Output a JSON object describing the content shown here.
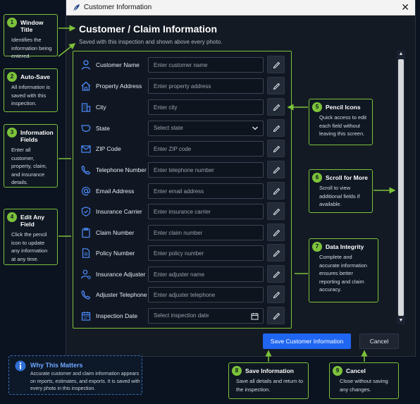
{
  "window": {
    "title": "Customer Information",
    "close": "✕"
  },
  "header": {
    "title": "Customer / Claim Information",
    "subtitle": "Saved with this inspection and shown above every photo."
  },
  "fields": [
    {
      "label": "Customer Name",
      "placeholder": "Enter customer name",
      "icon": "person-icon"
    },
    {
      "label": "Property Address",
      "placeholder": "Enter property address",
      "icon": "home-icon"
    },
    {
      "label": "City",
      "placeholder": "Enter city",
      "icon": "building-icon"
    },
    {
      "label": "State",
      "placeholder": "Select state",
      "icon": "map-icon",
      "type": "select"
    },
    {
      "label": "ZIP Code",
      "placeholder": "Enter ZIP code",
      "icon": "envelope-icon"
    },
    {
      "label": "Telephone Number",
      "placeholder": "Enter telephone number",
      "icon": "phone-icon"
    },
    {
      "label": "Email Address",
      "placeholder": "Enter email address",
      "icon": "at-sign-icon"
    },
    {
      "label": "Insurance Carrier",
      "placeholder": "Enter insurance carrier",
      "icon": "shield-icon"
    },
    {
      "label": "Claim Number",
      "placeholder": "Enter claim number",
      "icon": "clipboard-icon"
    },
    {
      "label": "Policy Number",
      "placeholder": "Enter policy number",
      "icon": "document-icon"
    },
    {
      "label": "Insurance Adjuster",
      "placeholder": "Enter adjuster name",
      "icon": "user-gear-icon"
    },
    {
      "label": "Adjuster Telephone",
      "placeholder": "Enter adjuster telephone",
      "icon": "phone-icon"
    },
    {
      "label": "Inspection Date",
      "placeholder": "Select inspection date",
      "icon": "calendar-icon",
      "type": "date"
    }
  ],
  "buttons": {
    "save": "Save Customer Information",
    "cancel": "Cancel"
  },
  "callouts": {
    "c1": {
      "num": "1",
      "title": "Window Title",
      "body": "Identifies the information being entered."
    },
    "c2": {
      "num": "2",
      "title": "Auto-Save",
      "body": "All information is saved with this inspection."
    },
    "c3": {
      "num": "3",
      "title": "Information Fields",
      "body": "Enter all customer, property, claim, and insurance details."
    },
    "c4": {
      "num": "4",
      "title": "Edit Any Field",
      "body": "Click the pencil icon to update any information at any time."
    },
    "c5": {
      "num": "5",
      "title": "Pencil Icons",
      "body": "Quick access to edit each field without leaving this screen."
    },
    "c6": {
      "num": "6",
      "title": "Scroll for More",
      "body": "Scroll to view additional fields if available."
    },
    "c7": {
      "num": "7",
      "title": "Data Integrity",
      "body": "Complete and accurate information ensures better reporting and claim accuracy."
    },
    "c8": {
      "num": "8",
      "title": "Save Information",
      "body": "Save all details and return to the inspection."
    },
    "c9": {
      "num": "9",
      "title": "Cancel",
      "body": "Close without saving any changes."
    }
  },
  "why": {
    "title": "Why This Matters",
    "body": "Accurate customer and claim information appears on reports, estimates, and exports. It is saved with every photo in this inspection."
  },
  "colors": {
    "accent_green": "#7cc23a",
    "primary_blue": "#1f66f2",
    "icon_blue": "#4d8dff"
  }
}
